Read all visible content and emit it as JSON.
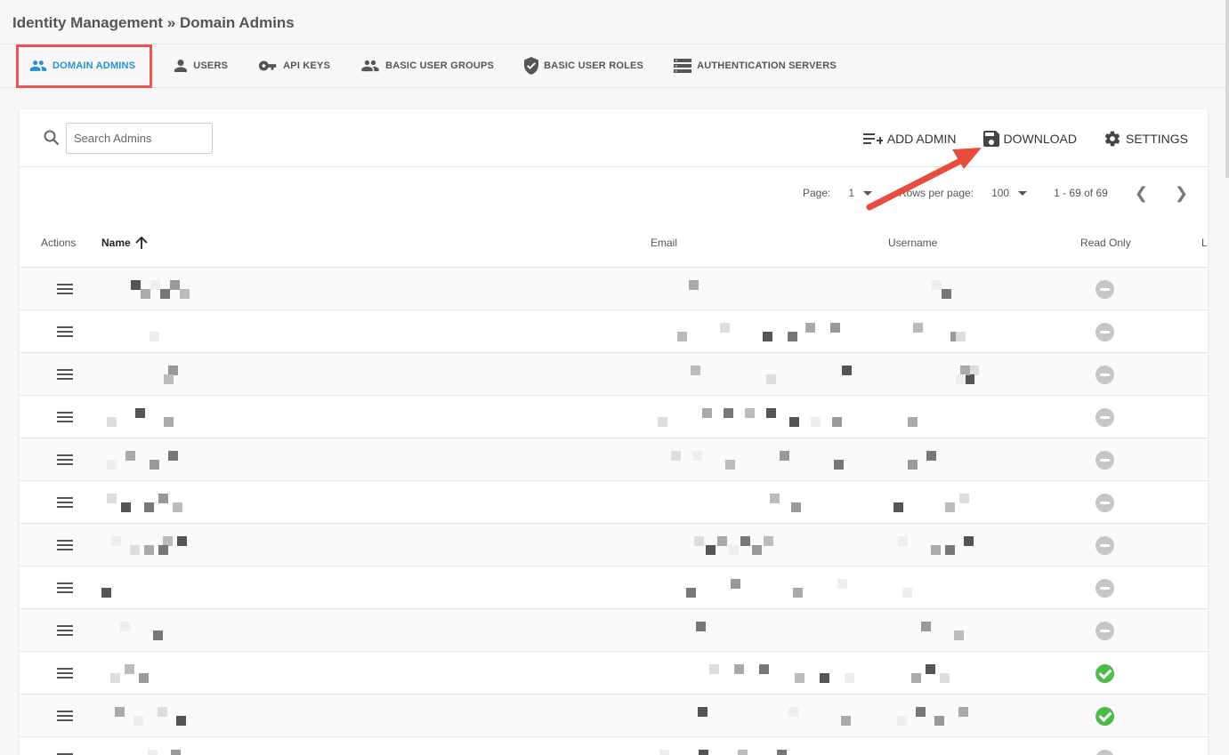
{
  "header": {
    "breadcrumb": "Identity Management » Domain Admins"
  },
  "tabs": [
    {
      "label": "DOMAIN ADMINS",
      "icon": "admins-icon",
      "active": true
    },
    {
      "label": "USERS",
      "icon": "user-icon",
      "active": false
    },
    {
      "label": "API KEYS",
      "icon": "key-icon",
      "active": false
    },
    {
      "label": "BASIC USER GROUPS",
      "icon": "group-icon",
      "active": false
    },
    {
      "label": "BASIC USER ROLES",
      "icon": "shield-icon",
      "active": false
    },
    {
      "label": "AUTHENTICATION SERVERS",
      "icon": "server-icon",
      "active": false
    }
  ],
  "toolbar": {
    "search_placeholder": "Search Admins",
    "add_admin": "ADD ADMIN",
    "download": "DOWNLOAD",
    "settings": "SETTINGS"
  },
  "pager": {
    "page_label": "Page:",
    "page_value": "1",
    "rows_label": "Rows per page:",
    "rows_value": "100",
    "range": "1 - 69 of 69"
  },
  "table": {
    "columns": [
      "Actions",
      "Name",
      "Email",
      "Username",
      "Read Only",
      "L"
    ],
    "rows": [
      {
        "read_only": false
      },
      {
        "read_only": false
      },
      {
        "read_only": false
      },
      {
        "read_only": false
      },
      {
        "read_only": false
      },
      {
        "read_only": false
      },
      {
        "read_only": false
      },
      {
        "read_only": false
      },
      {
        "read_only": false
      },
      {
        "read_only": true
      },
      {
        "read_only": true
      },
      {
        "read_only": false
      }
    ]
  },
  "colors": {
    "accent": "#2a8fd0",
    "highlight": "#ef5350",
    "ok": "#4cbb4c",
    "muted": "#c6c6c6"
  }
}
